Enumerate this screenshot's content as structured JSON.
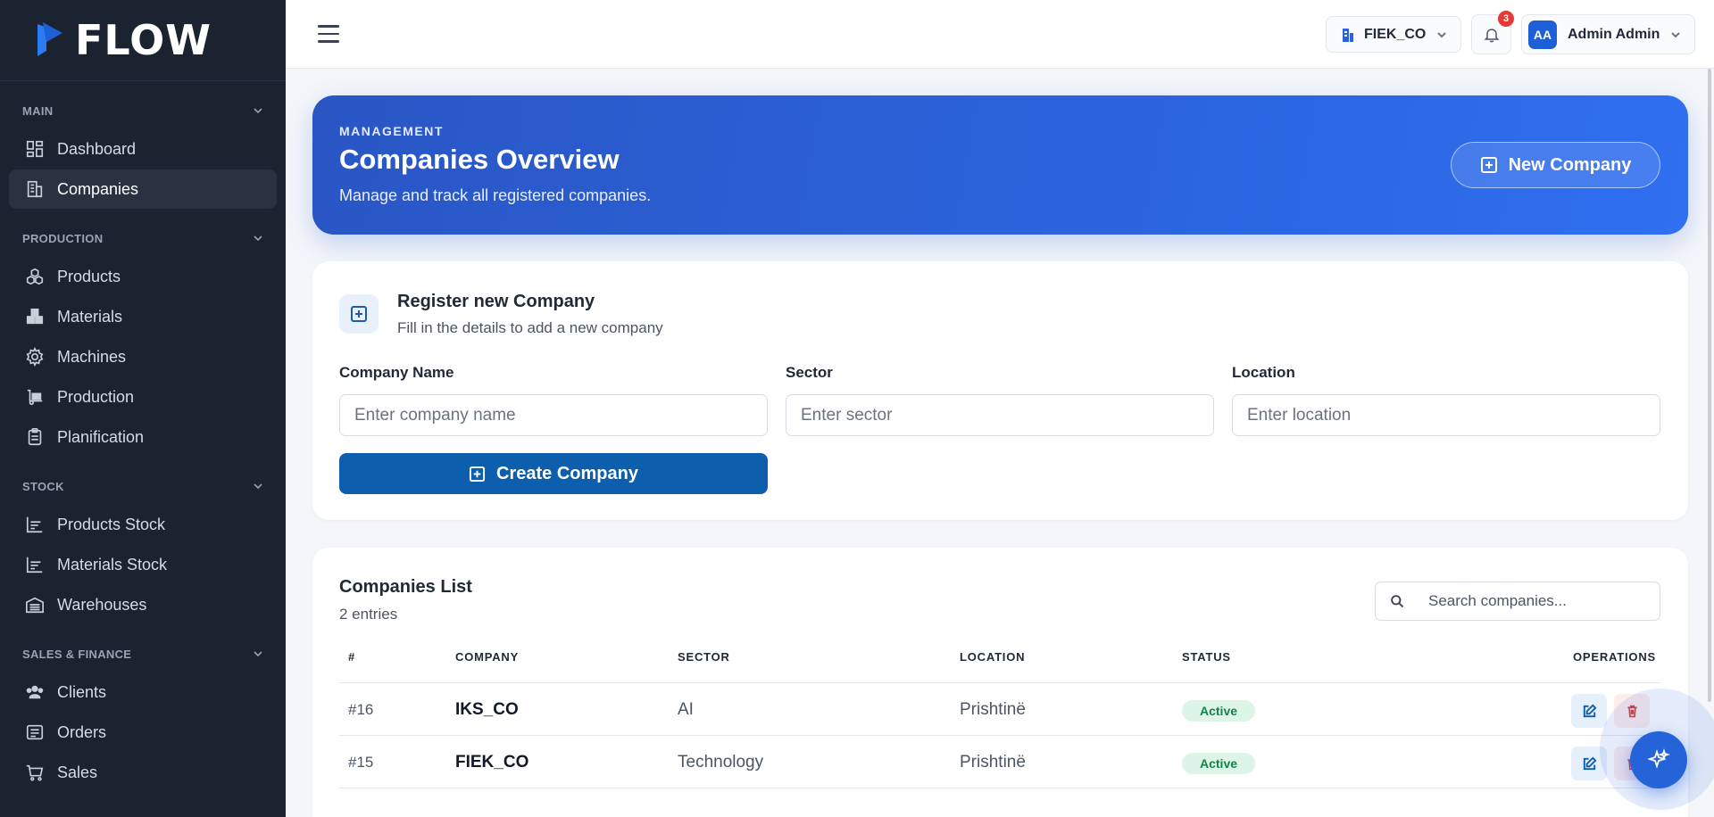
{
  "app": {
    "logo_text": "FLOW"
  },
  "sidebar": {
    "sections": [
      {
        "title": "MAIN",
        "items": [
          {
            "label": "Dashboard",
            "icon": "dashboard-icon",
            "active": false
          },
          {
            "label": "Companies",
            "icon": "building-icon",
            "active": true
          }
        ]
      },
      {
        "title": "PRODUCTION",
        "items": [
          {
            "label": "Products",
            "icon": "cubes-icon",
            "active": false
          },
          {
            "label": "Materials",
            "icon": "boxes-icon",
            "active": false
          },
          {
            "label": "Machines",
            "icon": "gear-icon",
            "active": false
          },
          {
            "label": "Production",
            "icon": "dolly-icon",
            "active": false
          },
          {
            "label": "Planification",
            "icon": "clipboard-icon",
            "active": false
          }
        ]
      },
      {
        "title": "STOCK",
        "items": [
          {
            "label": "Products Stock",
            "icon": "chart-bars-icon",
            "active": false
          },
          {
            "label": "Materials Stock",
            "icon": "chart-bars-icon",
            "active": false
          },
          {
            "label": "Warehouses",
            "icon": "warehouse-icon",
            "active": false
          }
        ]
      },
      {
        "title": "SALES & FINANCE",
        "items": [
          {
            "label": "Clients",
            "icon": "users-icon",
            "active": false
          },
          {
            "label": "Orders",
            "icon": "list-icon",
            "active": false
          },
          {
            "label": "Sales",
            "icon": "cart-icon",
            "active": false
          }
        ]
      }
    ]
  },
  "topbar": {
    "company_selector": "FIEK_CO",
    "notifications_count": "3",
    "user_initials": "AA",
    "user_name": "Admin Admin"
  },
  "hero": {
    "eyebrow": "MANAGEMENT",
    "title": "Companies Overview",
    "subtitle": "Manage and track all registered companies.",
    "new_button": "New Company"
  },
  "register": {
    "title": "Register new Company",
    "subtitle": "Fill in the details to add a new company",
    "fields": {
      "name_label": "Company Name",
      "name_placeholder": "Enter company name",
      "sector_label": "Sector",
      "sector_placeholder": "Enter sector",
      "location_label": "Location",
      "location_placeholder": "Enter location"
    },
    "create_button": "Create Company"
  },
  "list": {
    "title": "Companies List",
    "count": "2 entries",
    "search_placeholder": "Search companies...",
    "columns": [
      "#",
      "COMPANY",
      "SECTOR",
      "LOCATION",
      "STATUS",
      "OPERATIONS"
    ],
    "rows": [
      {
        "id": "#16",
        "company": "IKS_CO",
        "sector": "AI",
        "location": "Prishtinë",
        "status": "Active"
      },
      {
        "id": "#15",
        "company": "FIEK_CO",
        "sector": "Technology",
        "location": "Prishtinë",
        "status": "Active"
      }
    ]
  },
  "colors": {
    "sidebar_bg": "#1b2331",
    "accent": "#2b63dc",
    "primary_button": "#0d5fae",
    "status_active": "#13824a",
    "danger": "#e53935"
  }
}
